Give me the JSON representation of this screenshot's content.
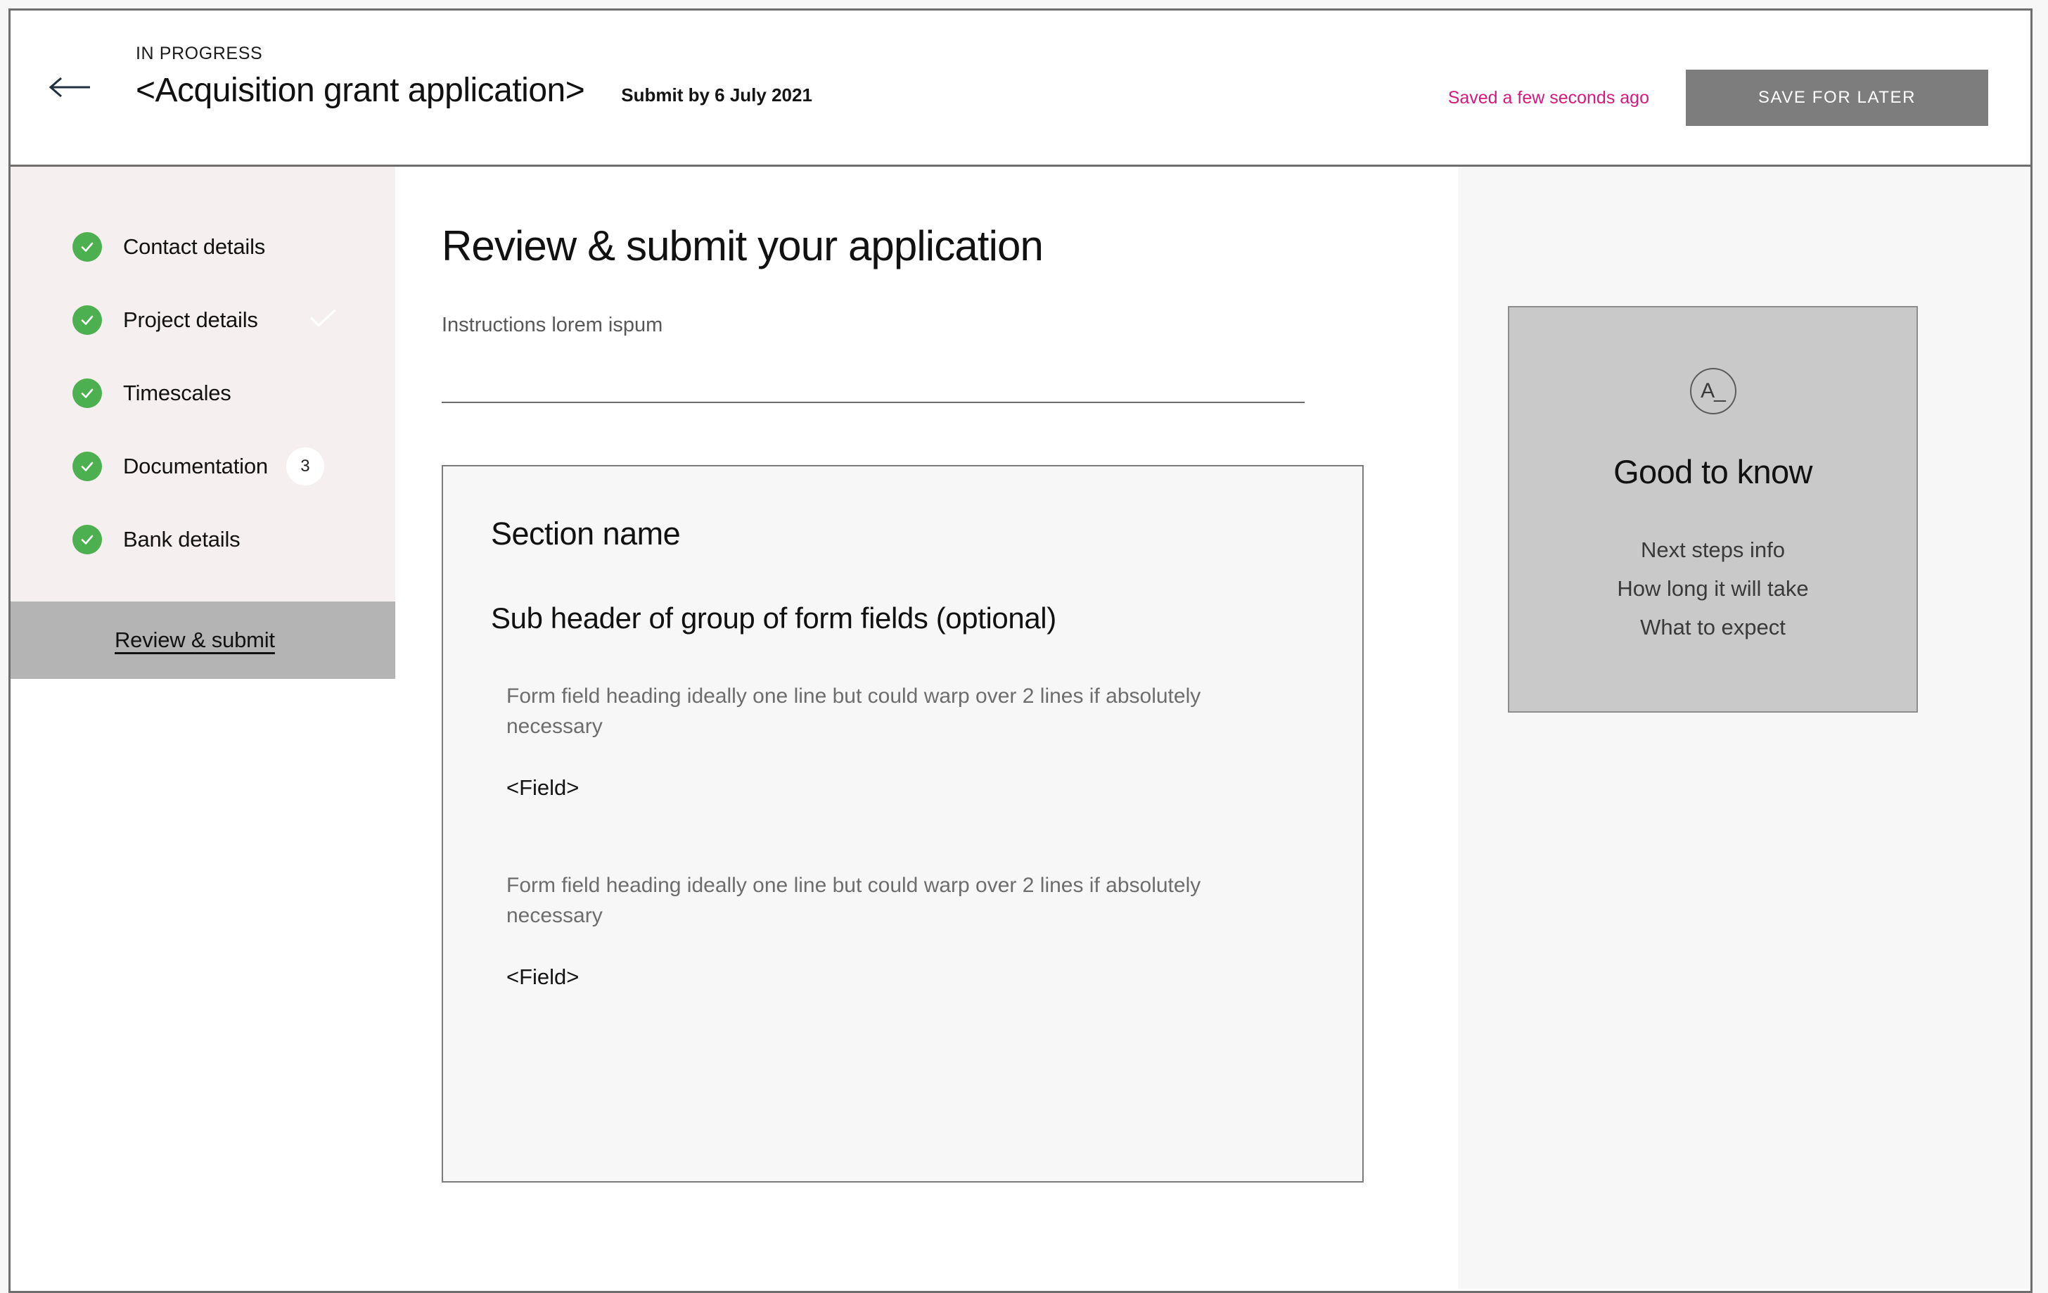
{
  "header": {
    "back_icon": "back-arrow-icon",
    "status_label": "IN PROGRESS",
    "title": "<Acquisition grant application>",
    "submit_by": "Submit by 6 July 2021",
    "saved_status": "Saved a few seconds ago",
    "save_button": "SAVE FOR LATER",
    "saved_status_color": "#d6197d",
    "save_button_bg": "#7d7d7d"
  },
  "sidebar": {
    "items": [
      {
        "label": "Contact details",
        "complete": true,
        "badge": null,
        "ghost_tick": false
      },
      {
        "label": "Project details",
        "complete": true,
        "badge": null,
        "ghost_tick": true
      },
      {
        "label": "Timescales",
        "complete": true,
        "badge": null,
        "ghost_tick": false
      },
      {
        "label": "Documentation",
        "complete": true,
        "badge": "3",
        "ghost_tick": false
      },
      {
        "label": "Bank details",
        "complete": true,
        "badge": null,
        "ghost_tick": false
      }
    ],
    "active_item": "Review & submit",
    "complete_color": "#4caf50",
    "active_bg": "#b4b4b4",
    "panel_bg": "#f5f0ef"
  },
  "main": {
    "page_title": "Review & submit your application",
    "instructions": "Instructions lorem ispum",
    "form": {
      "section_name": "Section name",
      "sub_header": "Sub header of group of form fields (optional)",
      "fields": [
        {
          "heading": "Form field heading ideally one line but could warp over 2 lines if absolutely necessary",
          "value": "<Field>"
        },
        {
          "heading": "Form field heading ideally one line but could warp over 2 lines if absolutely necessary",
          "value": "<Field>"
        }
      ]
    }
  },
  "info_panel": {
    "icon_text": "A_",
    "title": "Good to know",
    "lines": [
      "Next steps info",
      "How long it will take",
      "What to expect"
    ],
    "box_bg": "#c9c9c9"
  }
}
